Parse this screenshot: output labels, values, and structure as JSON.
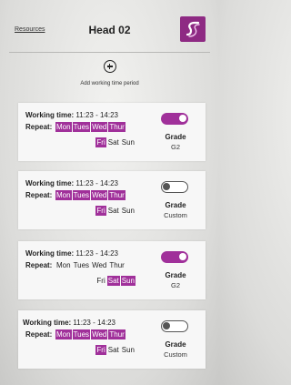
{
  "header": {
    "resources_label": "Resources",
    "title": "Head 02",
    "logo_icon": "brand-logo-icon"
  },
  "add_period": {
    "icon": "add-circle-icon",
    "label": "Add working time period"
  },
  "colors": {
    "accent": "#a0309a",
    "brand_logo": "#8e2a83"
  },
  "labels": {
    "working_time": "Working time:",
    "repeat": "Repeat:",
    "grade": "Grade"
  },
  "cards": [
    {
      "time": "11:23 - 14:23",
      "enabled": true,
      "grade_value": "G2",
      "days": [
        {
          "label": "Mon",
          "on": true
        },
        {
          "label": "Tues",
          "on": true
        },
        {
          "label": "Wed",
          "on": true
        },
        {
          "label": "Thur",
          "on": true
        },
        {
          "label": "Fri",
          "on": true
        },
        {
          "label": "Sat",
          "on": false
        },
        {
          "label": "Sun",
          "on": false
        }
      ]
    },
    {
      "time": "11:23 - 14:23",
      "enabled": false,
      "grade_value": "Custom",
      "days": [
        {
          "label": "Mon",
          "on": true
        },
        {
          "label": "Tues",
          "on": true
        },
        {
          "label": "Wed",
          "on": true
        },
        {
          "label": "Thur",
          "on": true
        },
        {
          "label": "Fri",
          "on": true
        },
        {
          "label": "Sat",
          "on": false
        },
        {
          "label": "Sun",
          "on": false
        }
      ]
    },
    {
      "time": "11:23 - 14:23",
      "enabled": true,
      "grade_value": "G2",
      "days": [
        {
          "label": "Mon",
          "on": false
        },
        {
          "label": "Tues",
          "on": false
        },
        {
          "label": "Wed",
          "on": false
        },
        {
          "label": "Thur",
          "on": false
        },
        {
          "label": "Fri",
          "on": false
        },
        {
          "label": "Sat",
          "on": true
        },
        {
          "label": "Sun",
          "on": true
        }
      ]
    },
    {
      "time": "11:23 - 14:23",
      "enabled": false,
      "grade_value": "Custom",
      "days": [
        {
          "label": "Mon",
          "on": true
        },
        {
          "label": "Tues",
          "on": true
        },
        {
          "label": "Wed",
          "on": true
        },
        {
          "label": "Thur",
          "on": true
        },
        {
          "label": "Fri",
          "on": true
        },
        {
          "label": "Sat",
          "on": false
        },
        {
          "label": "Sun",
          "on": false
        }
      ]
    }
  ]
}
